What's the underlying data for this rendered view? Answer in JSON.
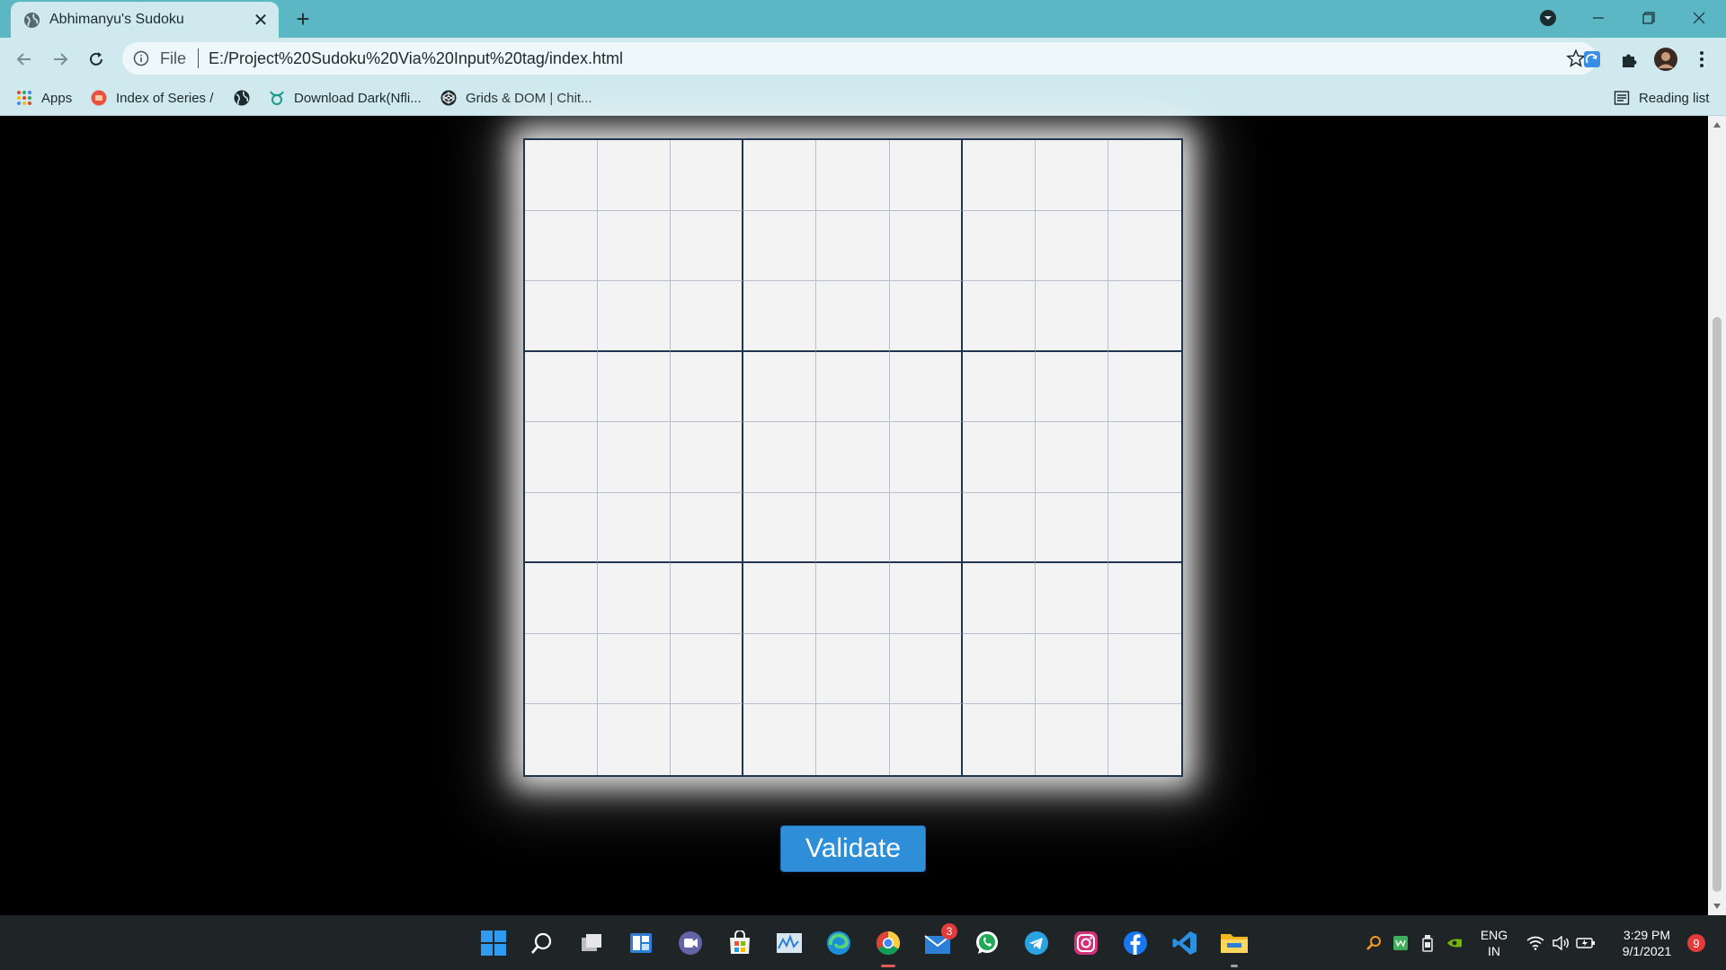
{
  "browser": {
    "tab_title": "Abhimanyu's Sudoku",
    "url_scheme": "File",
    "url": "E:/Project%20Sudoku%20Via%20Input%20tag/index.html"
  },
  "bookmarks": {
    "apps": "Apps",
    "items": [
      "Index of Series /",
      "Download Dark(Nfli...",
      "Grids & DOM | Chit..."
    ],
    "reading_list": "Reading list"
  },
  "sudoku": {
    "rows": 9,
    "cols": 9,
    "validate_label": "Validate"
  },
  "taskbar": {
    "mail_badge": "3",
    "lang_top": "ENG",
    "lang_bottom": "IN",
    "time": "3:29 PM",
    "date": "9/1/2021",
    "notification_count": "9"
  },
  "colors": {
    "titlebar": "#5bb7c3",
    "toolbar": "#cfe9ee",
    "validate_button": "#2e8fd8",
    "grid_major": "#1f3550",
    "grid_minor": "#b7bfcf"
  }
}
